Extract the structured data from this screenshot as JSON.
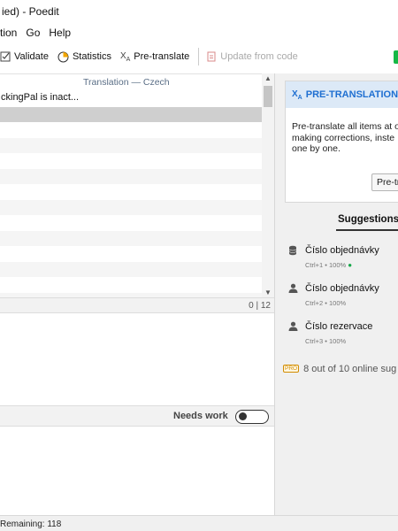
{
  "window": {
    "title": "ied) - Poedit"
  },
  "menu": [
    "tion",
    "Go",
    "Help"
  ],
  "toolbar": {
    "validate": "Validate",
    "statistics": "Statistics",
    "pretranslate": "Pre-translate",
    "update_from_code": "Update from code"
  },
  "list": {
    "column_header": "Translation — Czech",
    "first_row_text": "ckingPal is inact..."
  },
  "editor": {
    "counter": "0 | 12",
    "needs_work_label": "Needs work"
  },
  "sidebar": {
    "pretranslation": {
      "title": "PRE-TRANSLATION",
      "body_line1": "Pre-translate all items at o",
      "body_line2": "making corrections, inste",
      "body_line3": "one by one.",
      "button": "Pre-tra"
    },
    "suggestions_title": "Suggestions",
    "suggestions": [
      {
        "text": "Číslo objednávky",
        "meta": "Ctrl+1 • 100%",
        "icon": "database-icon"
      },
      {
        "text": "Číslo objednávky",
        "meta": "Ctrl+2 • 100%",
        "icon": "user-icon"
      },
      {
        "text": "Číslo rezervace",
        "meta": "Ctrl+3 • 100%",
        "icon": "user-icon"
      }
    ],
    "pro_badge": "PRO",
    "pro_text": "8 out of 10 online sug"
  },
  "status": {
    "remaining": "Remaining: 118"
  },
  "colors": {
    "accent": "#1f6fd1",
    "green": "#16b846",
    "pro": "#d28c00"
  }
}
